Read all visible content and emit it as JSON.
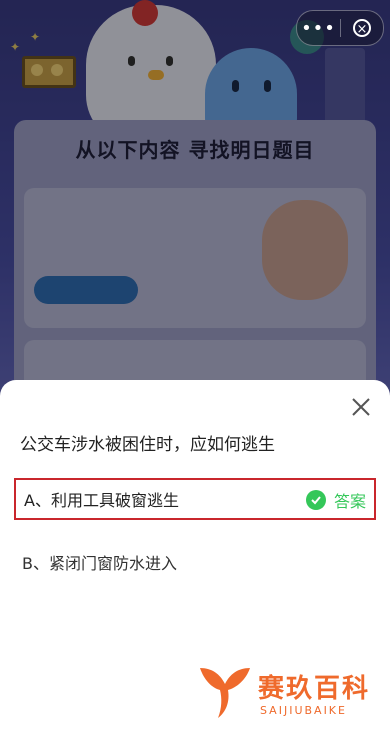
{
  "capsule": {
    "more_label": "•••",
    "close_symbol": "×"
  },
  "background": {
    "section_title": "从以下内容 寻找明日题目"
  },
  "question": {
    "text": "公交车涉水被困住时，应如何逃生",
    "options": [
      {
        "label": "A、利用工具破窗逃生",
        "is_answer": true
      },
      {
        "label": "B、紧闭门窗防水进入",
        "is_answer": false
      }
    ],
    "answer_label": "答案"
  },
  "brand": {
    "name": "赛玖百科",
    "sub": "SAIJIUBAIKE"
  },
  "colors": {
    "answer_green": "#34c759",
    "highlight_red": "#c9262c",
    "brand_orange": "#ef6a2c"
  }
}
